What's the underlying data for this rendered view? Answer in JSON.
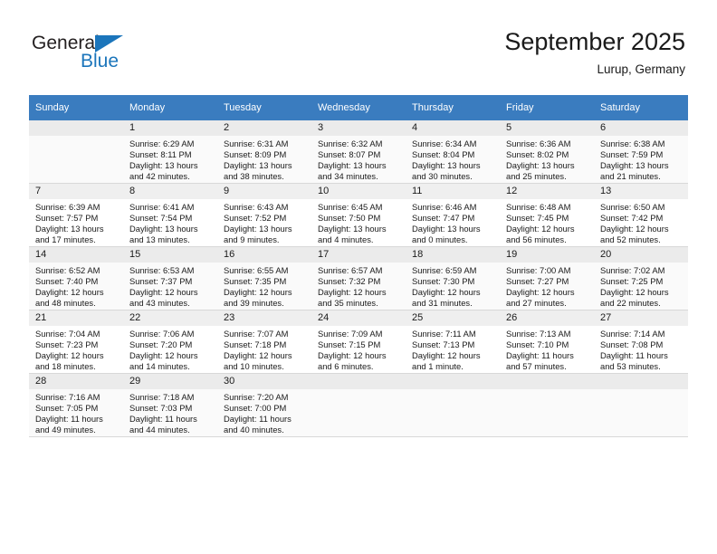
{
  "brand": {
    "name_part1": "General",
    "name_part2": "Blue",
    "triangle_color": "#1b75bb"
  },
  "header": {
    "title": "September 2025",
    "subtitle": "Lurup, Germany"
  },
  "theme": {
    "header_row_bg": "#3a7cbf",
    "header_row_text": "#ffffff",
    "daynum_band_bg": "#efefef",
    "shaded_row_bg": "#fafafa",
    "body_text": "#1a1a1a"
  },
  "calendar": {
    "weekday_headers": [
      "Sunday",
      "Monday",
      "Tuesday",
      "Wednesday",
      "Thursday",
      "Friday",
      "Saturday"
    ],
    "weeks": [
      [
        {
          "day": "",
          "lines": []
        },
        {
          "day": "1",
          "lines": [
            "Sunrise: 6:29 AM",
            "Sunset: 8:11 PM",
            "Daylight: 13 hours",
            "and 42 minutes."
          ]
        },
        {
          "day": "2",
          "lines": [
            "Sunrise: 6:31 AM",
            "Sunset: 8:09 PM",
            "Daylight: 13 hours",
            "and 38 minutes."
          ]
        },
        {
          "day": "3",
          "lines": [
            "Sunrise: 6:32 AM",
            "Sunset: 8:07 PM",
            "Daylight: 13 hours",
            "and 34 minutes."
          ]
        },
        {
          "day": "4",
          "lines": [
            "Sunrise: 6:34 AM",
            "Sunset: 8:04 PM",
            "Daylight: 13 hours",
            "and 30 minutes."
          ]
        },
        {
          "day": "5",
          "lines": [
            "Sunrise: 6:36 AM",
            "Sunset: 8:02 PM",
            "Daylight: 13 hours",
            "and 25 minutes."
          ]
        },
        {
          "day": "6",
          "lines": [
            "Sunrise: 6:38 AM",
            "Sunset: 7:59 PM",
            "Daylight: 13 hours",
            "and 21 minutes."
          ]
        }
      ],
      [
        {
          "day": "7",
          "lines": [
            "Sunrise: 6:39 AM",
            "Sunset: 7:57 PM",
            "Daylight: 13 hours",
            "and 17 minutes."
          ]
        },
        {
          "day": "8",
          "lines": [
            "Sunrise: 6:41 AM",
            "Sunset: 7:54 PM",
            "Daylight: 13 hours",
            "and 13 minutes."
          ]
        },
        {
          "day": "9",
          "lines": [
            "Sunrise: 6:43 AM",
            "Sunset: 7:52 PM",
            "Daylight: 13 hours",
            "and 9 minutes."
          ]
        },
        {
          "day": "10",
          "lines": [
            "Sunrise: 6:45 AM",
            "Sunset: 7:50 PM",
            "Daylight: 13 hours",
            "and 4 minutes."
          ]
        },
        {
          "day": "11",
          "lines": [
            "Sunrise: 6:46 AM",
            "Sunset: 7:47 PM",
            "Daylight: 13 hours",
            "and 0 minutes."
          ]
        },
        {
          "day": "12",
          "lines": [
            "Sunrise: 6:48 AM",
            "Sunset: 7:45 PM",
            "Daylight: 12 hours",
            "and 56 minutes."
          ]
        },
        {
          "day": "13",
          "lines": [
            "Sunrise: 6:50 AM",
            "Sunset: 7:42 PM",
            "Daylight: 12 hours",
            "and 52 minutes."
          ]
        }
      ],
      [
        {
          "day": "14",
          "lines": [
            "Sunrise: 6:52 AM",
            "Sunset: 7:40 PM",
            "Daylight: 12 hours",
            "and 48 minutes."
          ]
        },
        {
          "day": "15",
          "lines": [
            "Sunrise: 6:53 AM",
            "Sunset: 7:37 PM",
            "Daylight: 12 hours",
            "and 43 minutes."
          ]
        },
        {
          "day": "16",
          "lines": [
            "Sunrise: 6:55 AM",
            "Sunset: 7:35 PM",
            "Daylight: 12 hours",
            "and 39 minutes."
          ]
        },
        {
          "day": "17",
          "lines": [
            "Sunrise: 6:57 AM",
            "Sunset: 7:32 PM",
            "Daylight: 12 hours",
            "and 35 minutes."
          ]
        },
        {
          "day": "18",
          "lines": [
            "Sunrise: 6:59 AM",
            "Sunset: 7:30 PM",
            "Daylight: 12 hours",
            "and 31 minutes."
          ]
        },
        {
          "day": "19",
          "lines": [
            "Sunrise: 7:00 AM",
            "Sunset: 7:27 PM",
            "Daylight: 12 hours",
            "and 27 minutes."
          ]
        },
        {
          "day": "20",
          "lines": [
            "Sunrise: 7:02 AM",
            "Sunset: 7:25 PM",
            "Daylight: 12 hours",
            "and 22 minutes."
          ]
        }
      ],
      [
        {
          "day": "21",
          "lines": [
            "Sunrise: 7:04 AM",
            "Sunset: 7:23 PM",
            "Daylight: 12 hours",
            "and 18 minutes."
          ]
        },
        {
          "day": "22",
          "lines": [
            "Sunrise: 7:06 AM",
            "Sunset: 7:20 PM",
            "Daylight: 12 hours",
            "and 14 minutes."
          ]
        },
        {
          "day": "23",
          "lines": [
            "Sunrise: 7:07 AM",
            "Sunset: 7:18 PM",
            "Daylight: 12 hours",
            "and 10 minutes."
          ]
        },
        {
          "day": "24",
          "lines": [
            "Sunrise: 7:09 AM",
            "Sunset: 7:15 PM",
            "Daylight: 12 hours",
            "and 6 minutes."
          ]
        },
        {
          "day": "25",
          "lines": [
            "Sunrise: 7:11 AM",
            "Sunset: 7:13 PM",
            "Daylight: 12 hours",
            "and 1 minute."
          ]
        },
        {
          "day": "26",
          "lines": [
            "Sunrise: 7:13 AM",
            "Sunset: 7:10 PM",
            "Daylight: 11 hours",
            "and 57 minutes."
          ]
        },
        {
          "day": "27",
          "lines": [
            "Sunrise: 7:14 AM",
            "Sunset: 7:08 PM",
            "Daylight: 11 hours",
            "and 53 minutes."
          ]
        }
      ],
      [
        {
          "day": "28",
          "lines": [
            "Sunrise: 7:16 AM",
            "Sunset: 7:05 PM",
            "Daylight: 11 hours",
            "and 49 minutes."
          ]
        },
        {
          "day": "29",
          "lines": [
            "Sunrise: 7:18 AM",
            "Sunset: 7:03 PM",
            "Daylight: 11 hours",
            "and 44 minutes."
          ]
        },
        {
          "day": "30",
          "lines": [
            "Sunrise: 7:20 AM",
            "Sunset: 7:00 PM",
            "Daylight: 11 hours",
            "and 40 minutes."
          ]
        },
        {
          "day": "",
          "lines": []
        },
        {
          "day": "",
          "lines": []
        },
        {
          "day": "",
          "lines": []
        },
        {
          "day": "",
          "lines": []
        }
      ]
    ]
  }
}
